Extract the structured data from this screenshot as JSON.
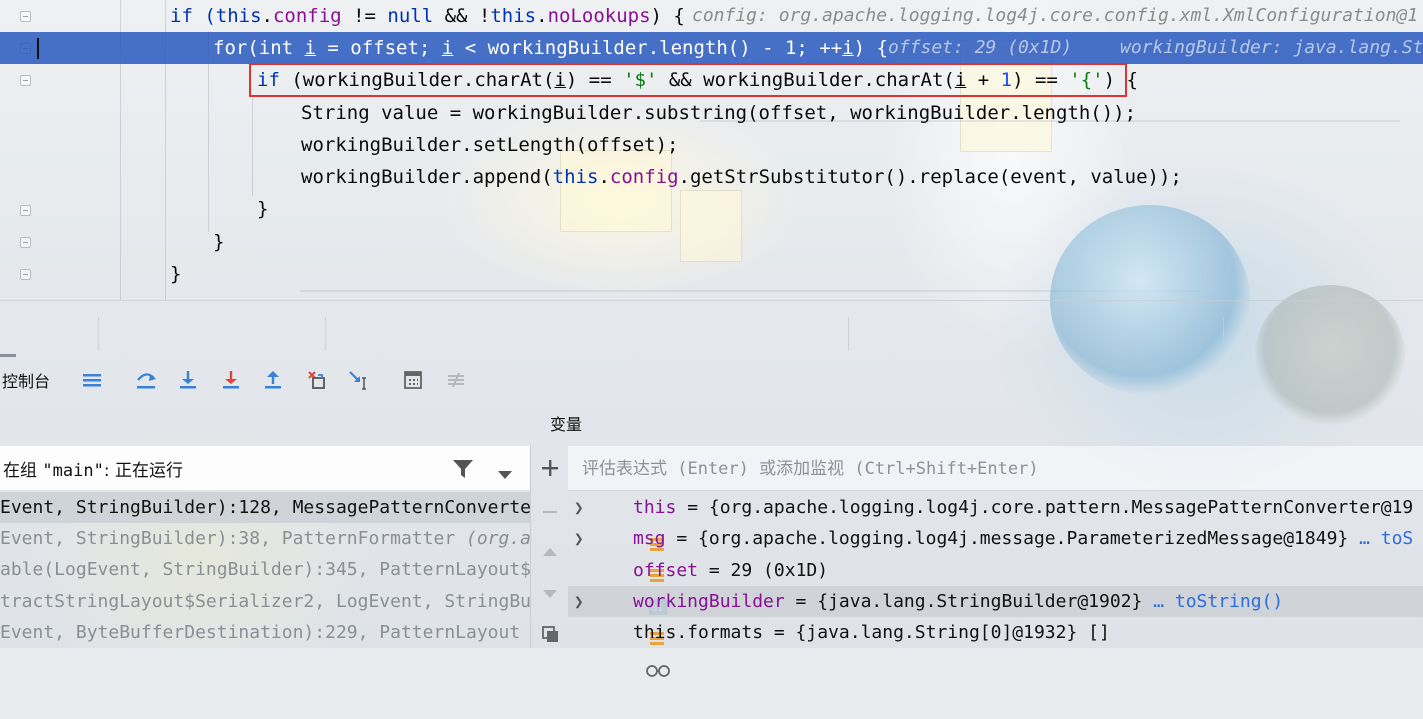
{
  "editor": {
    "lines": [
      {
        "a": "if (",
        "b": "this",
        "c": ".",
        "d": "config",
        "e": " != ",
        "f": "null",
        "g": " && !",
        "h": "this",
        "i": ".",
        "j": "noLookups",
        "k": ") {",
        "hint": "config: org.apache.logging.log4j.core.config.xml.XmlConfiguration@1"
      },
      {
        "a": "for(int ",
        "b": "i",
        "c": " = offset; ",
        "d": "i",
        "e": " < workingBuilder.length() - 1; ++",
        "f": "i",
        "g": ") {",
        "hint1": "offset: 29 (0x1D)",
        "hint2": "workingBuilder: java.lang.St"
      },
      {
        "a": "if",
        "b": " (workingBuilder.charAt(",
        "c": "i",
        "d": ") == ",
        "e": "'$'",
        "f": " && workingBuilder.charAt(",
        "g": "i",
        "h": " + ",
        "i": "1",
        "j": ") == ",
        "k": "'{'",
        "l": ") {"
      },
      {
        "text": "String value = workingBuilder.substring(offset, workingBuilder.length());"
      },
      {
        "text": "workingBuilder.setLength(offset);"
      },
      {
        "a": "workingBuilder.append(",
        "b": "this",
        "c": ".",
        "d": "config",
        "e": ".getStrSubstitutor().replace(event, value));"
      },
      {
        "text": "}"
      },
      {
        "text": "}"
      },
      {
        "text": "}"
      }
    ]
  },
  "toolbar": {
    "console_tab": "控制台",
    "icons": [
      "layout-icon",
      "step-over-icon",
      "step-into-icon",
      "force-step-into-icon",
      "step-out-icon",
      "drop-frame-icon",
      "run-to-cursor-icon",
      "evaluate-expression-icon",
      "trace-current-stream-icon"
    ]
  },
  "frames": {
    "thread_prefix": "在组",
    "thread_name": "\"main\"",
    "thread_status": ": 正在运行",
    "rows": [
      {
        "text": "Event, StringBuilder):128, MessagePatternConverte",
        "cls": ""
      },
      {
        "text": "Event, StringBuilder):38, PatternFormatter ",
        "cls": "(org.a"
      },
      {
        "text": "able(LogEvent, StringBuilder):345, PatternLayout$",
        "cls": ""
      },
      {
        "text": "tractStringLayout$Serializer2, LogEvent, StringBu",
        "cls": ""
      },
      {
        "text": "Event, ByteBufferDestination):229, PatternLayout",
        "cls": ""
      }
    ]
  },
  "variables": {
    "title": "变量",
    "eval_placeholder": "评估表达式 (Enter) 或添加监视 (Ctrl+Shift+Enter)",
    "rows": [
      {
        "name": "this",
        "value": " = {org.apache.logging.log4j.core.pattern.MessagePatternConverter@19",
        "link": "",
        "icon": "field-object-icon",
        "expandable": true
      },
      {
        "name": "msg",
        "value": " = {org.apache.logging.log4j.message.ParameterizedMessage@1849} ",
        "link": "… toS",
        "icon": "field-object-icon",
        "expandable": true
      },
      {
        "name": "offset",
        "value": " = 29 (0x1D)",
        "link": "",
        "icon": "primitive-int-icon",
        "expandable": false
      },
      {
        "name": "workingBuilder",
        "value": " = {java.lang.StringBuilder@1902} ",
        "link": "… toString()",
        "icon": "field-object-icon",
        "expandable": true
      },
      {
        "name": "this.formats",
        "value": " = {java.lang.String[0]@1932} []",
        "link": "",
        "icon": "watch-glasses-icon",
        "expandable": false
      }
    ]
  },
  "colors": {
    "highlight_line": "#2858be",
    "red_box": "#e0322f",
    "keyword": "#0033b3",
    "field": "#871094",
    "string": "#067d17",
    "number": "#1750eb",
    "debug_icon_blue": "#3b82d6",
    "debug_icon_red": "#e2443b"
  }
}
